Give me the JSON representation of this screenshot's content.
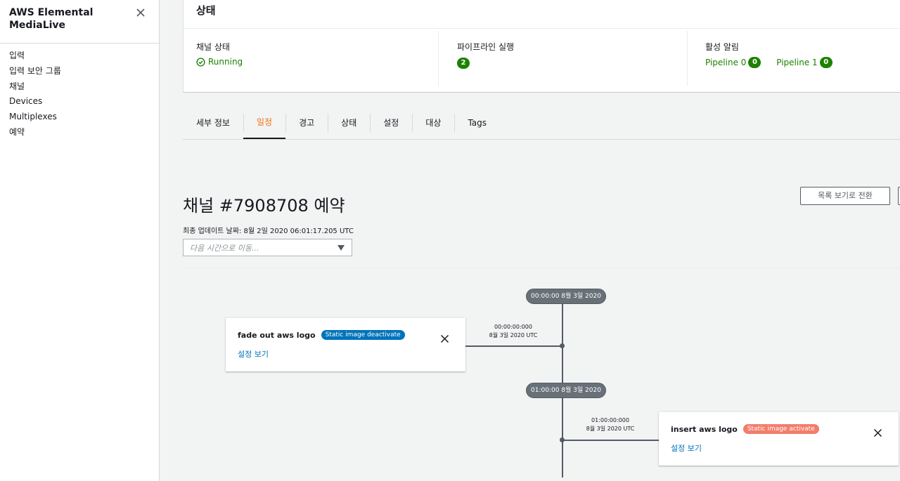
{
  "sidebar": {
    "title": "AWS Elemental MediaLive",
    "items": [
      {
        "label": "입력"
      },
      {
        "label": "입력 보안 그룹"
      },
      {
        "label": "채널"
      },
      {
        "label": "Devices"
      },
      {
        "label": "Multiplexes"
      },
      {
        "label": "예약"
      }
    ]
  },
  "status": {
    "heading": "상태",
    "channel_state_label": "채널 상태",
    "channel_state_value": "Running",
    "pipelines_running_label": "파이프라인 실행",
    "pipelines_running_count": "2",
    "alerts_label": "활성 알림",
    "pipeline0_label": "Pipeline 0",
    "pipeline0_count": "0",
    "pipeline1_label": "Pipeline 1",
    "pipeline1_count": "0"
  },
  "tabs": [
    {
      "label": "세부 정보"
    },
    {
      "label": "일정",
      "active": true
    },
    {
      "label": "경고"
    },
    {
      "label": "상태"
    },
    {
      "label": "설정"
    },
    {
      "label": "대상"
    },
    {
      "label": "Tags"
    }
  ],
  "schedule": {
    "title": "채널 #7908708 예약",
    "last_updated": "최종 업데이트 날짜: 8월 2일 2020 06:01:17.205 UTC",
    "goto_placeholder": "다음 시간으로 이동...",
    "list_view_button": "목록 보기로 전환"
  },
  "timeline": {
    "markers": [
      {
        "label": "00:00:00 8월 3일 2020"
      },
      {
        "label": "01:00:00 8월 3일 2020"
      }
    ],
    "actions": [
      {
        "time": "00:00:00:000",
        "date": "8월 3일 2020 UTC",
        "name": "fade out aws logo",
        "type": "Static image deactivate",
        "link": "설정 보기"
      },
      {
        "time": "01:00:00:000",
        "date": "8월 3일 2020 UTC",
        "name": "insert aws logo",
        "type": "Static image activate",
        "link": "설정 보기"
      }
    ]
  },
  "colors": {
    "accent_orange": "#ec7211",
    "status_green": "#1d8102",
    "link_blue": "#0073bb",
    "tag_red": "#f27d6b"
  }
}
